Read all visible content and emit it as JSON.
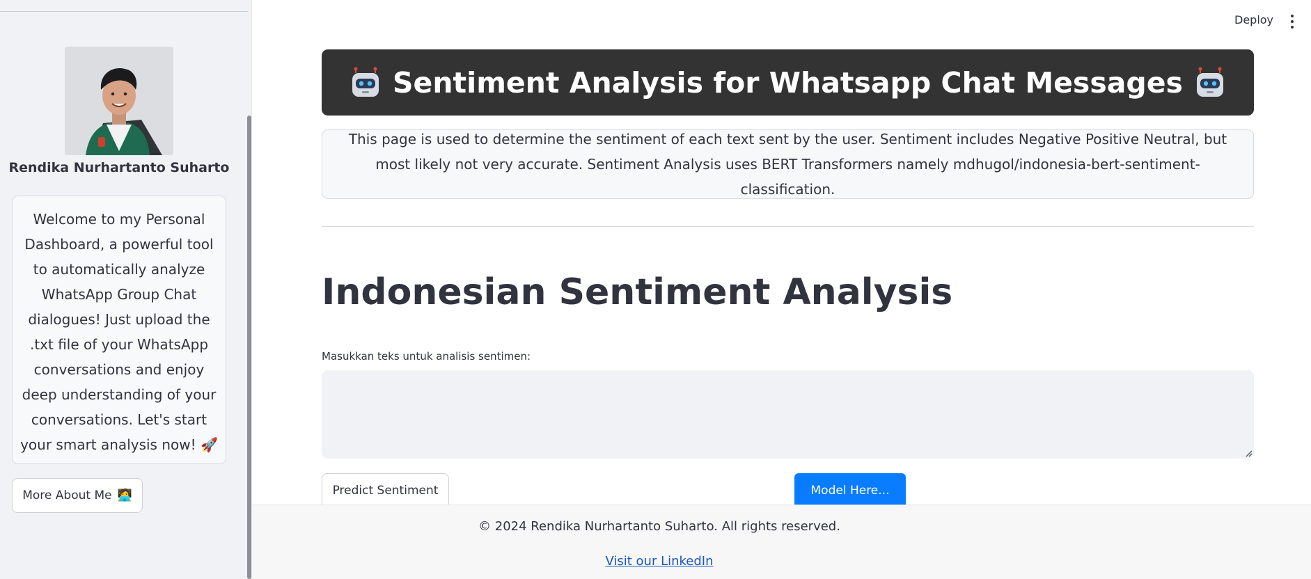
{
  "header": {
    "deploy_label": "Deploy",
    "menu_icon": "kebab-menu-icon"
  },
  "sidebar": {
    "avatar_icon": "profile-photo",
    "author_name": "Rendika Nurhartanto Suharto",
    "welcome_text": "Welcome to my Personal Dashboard, a powerful tool to automatically analyze WhatsApp Group Chat dialogues! Just upload the .txt file of your WhatsApp conversations and enjoy deep understanding of your conversations. Let's start your smart analysis now! 🚀",
    "about_button_label": "More About Me",
    "about_button_emoji": "🧑‍💻"
  },
  "main": {
    "title": "Sentiment Analysis for Whatsapp Chat Messages",
    "title_icon": "robot-icon",
    "info_text": "This page is used to determine the sentiment of each text sent by the user. Sentiment includes Negative Positive Neutral, but most likely not very accurate. Sentiment Analysis uses BERT Transformers namely mdhugol/indonesia-bert-sentiment-classification.",
    "section_heading": "Indonesian Sentiment Analysis",
    "input_label": "Masukkan teks untuk analisis sentimen:",
    "input_value": "",
    "predict_button_label": "Predict Sentiment",
    "model_button_label": "Model Here..."
  },
  "footer": {
    "copyright": "© 2024 Rendika Nurhartanto Suharto. All rights reserved.",
    "link_text": "Visit our LinkedIn"
  },
  "colors": {
    "sidebar_bg": "#f0f2f6",
    "banner_bg": "#333333",
    "primary_button": "#0a7cff",
    "link": "#1a56c0",
    "text": "#31333f"
  }
}
